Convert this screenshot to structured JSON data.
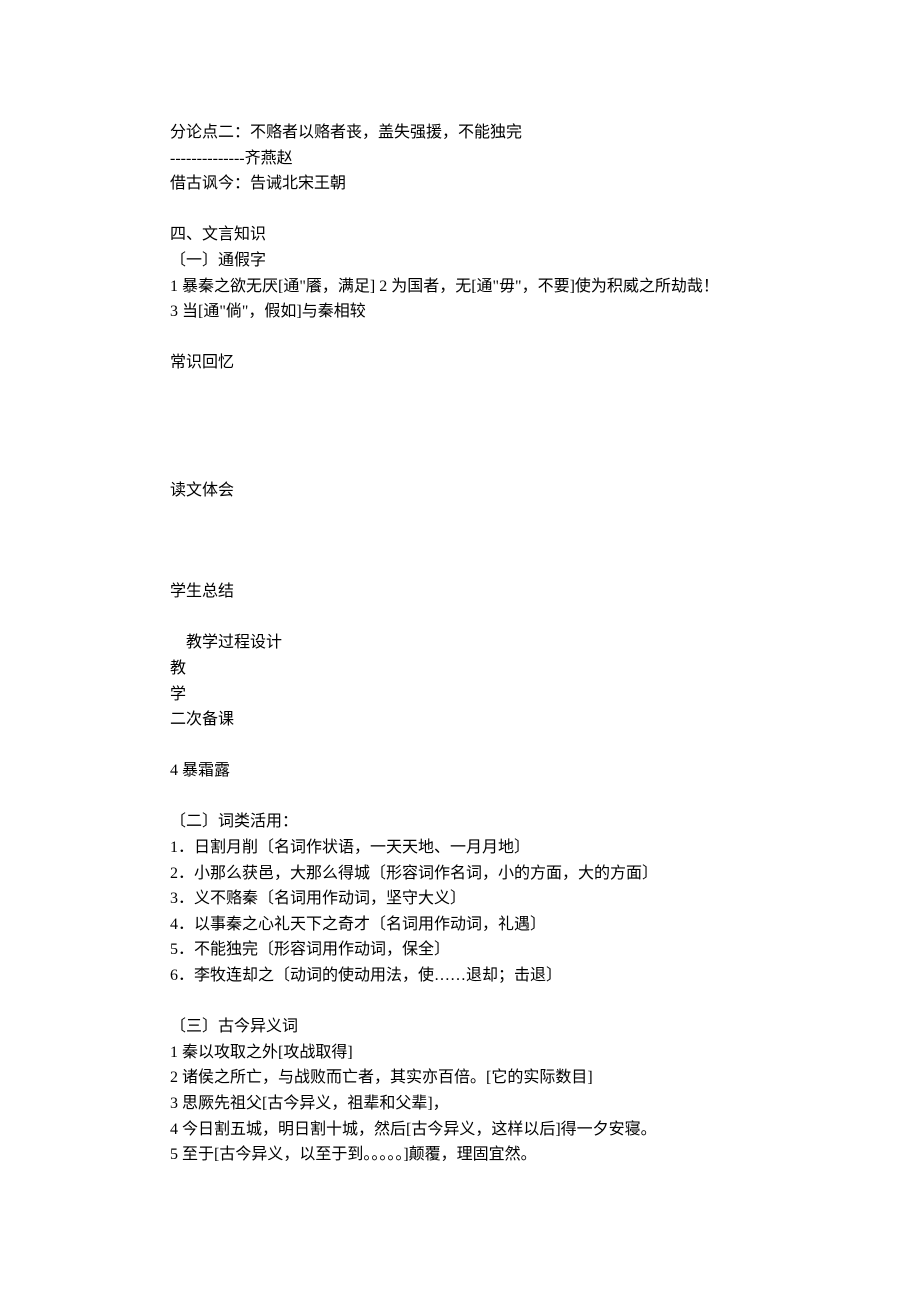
{
  "lines": {
    "l1": "分论点二：不赂者以赂者丧，盖失强援，不能独完",
    "l2": "--------------齐燕赵",
    "l3": "借古讽今：告诫北宋王朝",
    "l4": "四、文言知识",
    "l5": "〔一〕通假字",
    "l6": "1 暴秦之欲无厌[通\"餍，满足] 2 为国者，无[通\"毋\"，不要]使为积威之所劫哉！",
    "l7": "3 当[通\"倘\"，假如]与秦相较",
    "l8": "常识回忆",
    "l9": "读文体会",
    "l10": "学生总结",
    "l11": "教学过程设计",
    "l12": "教",
    "l13": "学",
    "l14": "二次备课",
    "l15": "4 暴霜露",
    "l16": "〔二〕词类活用：",
    "l17": "1．日割月削〔名词作状语，一天天地、一月月地〕",
    "l18": "2．小那么获邑，大那么得城〔形容词作名词，小的方面，大的方面〕",
    "l19": "3．义不赂秦〔名词用作动词，坚守大义〕",
    "l20": "4．以事秦之心礼天下之奇才〔名词用作动词，礼遇〕",
    "l21": "5．不能独完〔形容词用作动词，保全〕",
    "l22": "6．李牧连却之〔动词的使动用法，使……退却；击退〕",
    "l23": "〔三〕古今异义词",
    "l24": "1 秦以攻取之外[攻战取得]",
    "l25": "2 诸侯之所亡，与战败而亡者，其实亦百倍。[它的实际数目]",
    "l26": "3 思厥先祖父[古今异义，祖辈和父辈]，",
    "l27": "4 今日割五城，明日割十城，然后[古今异义，这样以后]得一夕安寝。",
    "l28": "5 至于[古今异义，以至于到。。。。。]颠覆，理固宜然。"
  }
}
